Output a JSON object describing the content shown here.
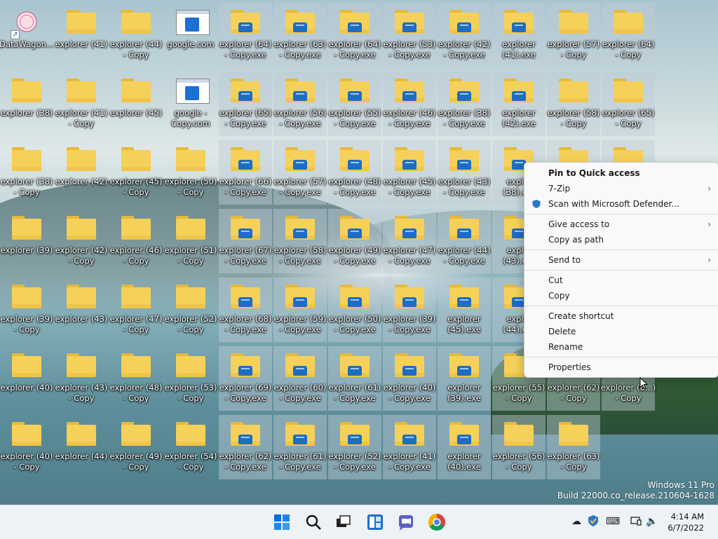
{
  "desktop": {
    "columns": [
      [
        {
          "label": "DataWagon...",
          "type": "app"
        },
        {
          "label": "explorer (38)",
          "type": "folder"
        },
        {
          "label": "explorer (38) - Copy",
          "type": "folder"
        },
        {
          "label": "explorer (39)",
          "type": "folder"
        },
        {
          "label": "explorer (39) - Copy",
          "type": "folder"
        },
        {
          "label": "explorer (40)",
          "type": "folder"
        },
        {
          "label": "explorer (40) - Copy",
          "type": "folder"
        }
      ],
      [
        {
          "label": "explorer (41)",
          "type": "folder"
        },
        {
          "label": "explorer (41) - Copy",
          "type": "folder"
        },
        {
          "label": "explorer (42)",
          "type": "folder"
        },
        {
          "label": "explorer (42) - Copy",
          "type": "folder"
        },
        {
          "label": "explorer (43)",
          "type": "folder"
        },
        {
          "label": "explorer (43) - Copy",
          "type": "folder"
        },
        {
          "label": "explorer (44)",
          "type": "folder"
        }
      ],
      [
        {
          "label": "explorer (44) - Copy",
          "type": "folder"
        },
        {
          "label": "explorer (45)",
          "type": "folder"
        },
        {
          "label": "explorer (45) - Copy",
          "type": "folder"
        },
        {
          "label": "explorer (46) - Copy",
          "type": "folder"
        },
        {
          "label": "explorer (47) - Copy",
          "type": "folder"
        },
        {
          "label": "explorer (48) - Copy",
          "type": "folder"
        },
        {
          "label": "explorer (49) - Copy",
          "type": "folder"
        }
      ],
      [
        {
          "label": "google.com",
          "type": "web"
        },
        {
          "label": "google - Copy.com",
          "type": "web"
        },
        {
          "label": "explorer (50) - Copy",
          "type": "folder"
        },
        {
          "label": "explorer (51) - Copy",
          "type": "folder"
        },
        {
          "label": "explorer (52) - Copy",
          "type": "folder"
        },
        {
          "label": "explorer (53) - Copy",
          "type": "folder"
        },
        {
          "label": "explorer (54) - Copy",
          "type": "folder"
        }
      ],
      [
        {
          "label": "explorer (64) - Copy.exe",
          "type": "exe"
        },
        {
          "label": "explorer (65) - Copy.exe",
          "type": "exe"
        },
        {
          "label": "explorer (66) - Copy.exe",
          "type": "exe"
        },
        {
          "label": "explorer (67) - Copy.exe",
          "type": "exe"
        },
        {
          "label": "explorer (68) - Copy.exe",
          "type": "exe"
        },
        {
          "label": "explorer (69) - Copy.exe",
          "type": "exe"
        },
        {
          "label": "explorer (62) - Copy.exe",
          "type": "exe"
        }
      ],
      [
        {
          "label": "explorer (63) - Copy.exe",
          "type": "exe"
        },
        {
          "label": "explorer (56) - Copy.exe",
          "type": "exe"
        },
        {
          "label": "explorer (57) - Copy.exe",
          "type": "exe"
        },
        {
          "label": "explorer (58) - Copy.exe",
          "type": "exe"
        },
        {
          "label": "explorer (59) - Copy.exe",
          "type": "exe"
        },
        {
          "label": "explorer (60) - Copy.exe",
          "type": "exe"
        },
        {
          "label": "explorer (61) - Copy.exe",
          "type": "exe"
        }
      ],
      [
        {
          "label": "explorer (64) - Copy.exe",
          "type": "exe"
        },
        {
          "label": "explorer (55) - Copy.exe",
          "type": "exe"
        },
        {
          "label": "explorer (48) - Copy.exe",
          "type": "exe"
        },
        {
          "label": "explorer (49) - Copy.exe",
          "type": "exe"
        },
        {
          "label": "explorer (50) - Copy.exe",
          "type": "exe"
        },
        {
          "label": "explorer (61) - Copy.exe",
          "type": "exe"
        },
        {
          "label": "explorer (52) - Copy.exe",
          "type": "exe"
        }
      ],
      [
        {
          "label": "explorer (53) - Copy.exe",
          "type": "exe"
        },
        {
          "label": "explorer (46) - Copy.exe",
          "type": "exe"
        },
        {
          "label": "explorer (45) - Copy.exe",
          "type": "exe"
        },
        {
          "label": "explorer (47) - Copy.exe",
          "type": "exe"
        },
        {
          "label": "explorer (39) - Copy.exe",
          "type": "exe"
        },
        {
          "label": "explorer (40) - Copy.exe",
          "type": "exe"
        },
        {
          "label": "explorer (41) - Copy.exe",
          "type": "exe"
        }
      ],
      [
        {
          "label": "explorer (42) - Copy.exe",
          "type": "exe"
        },
        {
          "label": "explorer (38) - Copy.exe",
          "type": "exe"
        },
        {
          "label": "explorer (43) - Copy.exe",
          "type": "exe"
        },
        {
          "label": "explorer (44) - Copy.exe",
          "type": "exe"
        },
        {
          "label": "explorer (45).exe",
          "type": "exe"
        },
        {
          "label": "explorer (39).exe",
          "type": "exe"
        },
        {
          "label": "explorer (40).exe",
          "type": "exe"
        }
      ],
      [
        {
          "label": "explorer (41).exe",
          "type": "exe"
        },
        {
          "label": "explorer (42).exe",
          "type": "exe"
        },
        {
          "label": "expl... (38).e...",
          "type": "exe"
        },
        {
          "label": "expl... (43).e...",
          "type": "exe"
        },
        {
          "label": "expl... (44).e...",
          "type": "exe"
        },
        {
          "label": "explorer (55) - Copy",
          "type": "folder"
        },
        {
          "label": "explorer (56) - Copy",
          "type": "folder"
        }
      ],
      [
        {
          "label": "explorer (57) - Copy",
          "type": "folder"
        },
        {
          "label": "explorer (58) - Copy",
          "type": "folder"
        },
        {
          "label": "",
          "type": "folder"
        },
        {
          "label": "",
          "type": "folder"
        },
        {
          "label": "",
          "type": "folder"
        },
        {
          "label": "explorer (62) - Copy",
          "type": "folder"
        },
        {
          "label": "explorer (63) - Copy",
          "type": "folder"
        }
      ],
      [
        {
          "label": "explorer (64) - Copy",
          "type": "folder"
        },
        {
          "label": "explorer (65) - Copy",
          "type": "folder"
        },
        {
          "label": "",
          "type": "folder"
        },
        {
          "label": "",
          "type": "none"
        },
        {
          "label": "",
          "type": "none"
        },
        {
          "label": "explorer (6...) - Copy",
          "type": "folder"
        },
        {
          "label": "",
          "type": "none"
        }
      ]
    ]
  },
  "context_menu": {
    "items": [
      {
        "label": "Pin to Quick access",
        "bold": true
      },
      {
        "label": "7-Zip",
        "submenu": true
      },
      {
        "label": "Scan with Microsoft Defender...",
        "icon": "shield-icon"
      },
      {
        "sep": true
      },
      {
        "label": "Give access to",
        "submenu": true
      },
      {
        "label": "Copy as path"
      },
      {
        "sep": true
      },
      {
        "label": "Send to",
        "submenu": true
      },
      {
        "sep": true
      },
      {
        "label": "Cut"
      },
      {
        "label": "Copy"
      },
      {
        "sep": true
      },
      {
        "label": "Create shortcut"
      },
      {
        "label": "Delete"
      },
      {
        "label": "Rename"
      },
      {
        "sep": true
      },
      {
        "label": "Properties"
      }
    ],
    "chevron": "›"
  },
  "watermark": {
    "line1": "Windows 11 Pro",
    "line2": "Build 22000.co_release.210604-1628"
  },
  "taskbar": {
    "apps": [
      "start-icon",
      "search-icon",
      "task-view-icon",
      "widgets-icon",
      "chat-icon",
      "chrome-icon"
    ],
    "tray": [
      "onedrive-icon",
      "security-icon",
      "keyboard-icon",
      "network-icon",
      "volume-icon"
    ],
    "time": "4:14 AM",
    "date": "6/7/2022"
  },
  "colors": {
    "folder": "#f5d15a",
    "accent": "#0067c0",
    "menu_bg": "#f9f9f9"
  }
}
